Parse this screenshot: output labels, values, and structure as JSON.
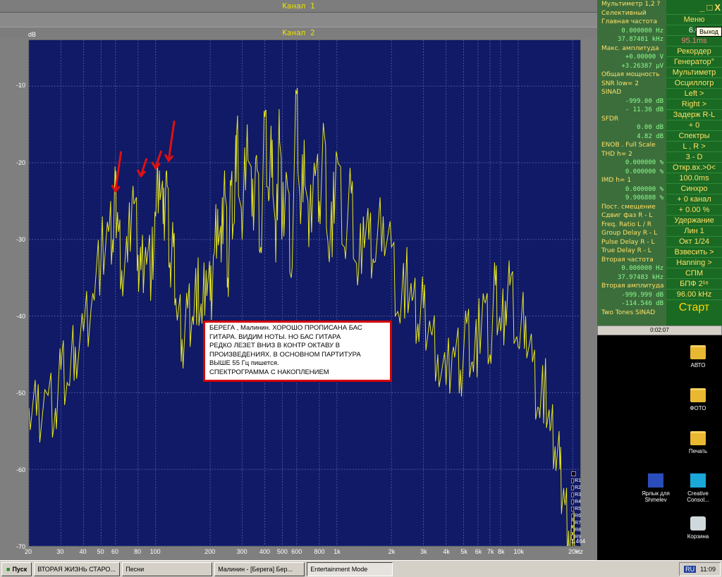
{
  "channel1_title": "Канал 1",
  "channel2_title": "Канал 2",
  "y_unit": "dB",
  "y_ticks": [
    "-10",
    "-20",
    "-30",
    "-40",
    "-50",
    "-60",
    "-70"
  ],
  "x_ticks": [
    "20",
    "30",
    "40",
    "50",
    "60",
    "80",
    "100",
    "200",
    "300",
    "400",
    "500",
    "600",
    "800",
    "1k",
    "2k",
    "3k",
    "4k",
    "5k",
    "6k",
    "7k",
    "8k",
    "10k",
    "20k",
    "Hz"
  ],
  "annotation": {
    "lines": [
      "БЕРЕГА , Малинин. ХОРОШО ПРОПИСАНА БАС",
      "ГИТАРА. ВИДИМ НОТЫ. НО БАС ГИТАРА",
      "РЕДКО ЛЕЗЕТ ВНИЗ В КОНТР ОКТАВУ В",
      "ПРОИЗВЕДЕНИЯХ. В ОСНОВНОМ ПАРТИТУРА",
      "ВЫШЕ 55 Гц пишется.",
      "СПЕКТРОГРАММА С НАКОПЛЕНИЕМ"
    ]
  },
  "legend": [
    "",
    "R1",
    "R2",
    "R3",
    "R4",
    "R5",
    "R6",
    "R7",
    "R8",
    "R9"
  ],
  "min_value": "1.464",
  "panel": [
    {
      "t": "Мультиметр 1,2  ?",
      "k": "h"
    },
    {
      "t": "Селективный",
      "k": "h"
    },
    {
      "t": "Главная частота",
      "k": "h"
    },
    {
      "t": "0.000000  Hz",
      "k": "v"
    },
    {
      "t": "37.87481 kHz",
      "k": "v"
    },
    {
      "t": "Макс. амплитуда",
      "k": "h"
    },
    {
      "t": "+0.00000  V",
      "k": "v"
    },
    {
      "t": "+3.26387 μV",
      "k": "v"
    },
    {
      "t": "Общая мощность",
      "k": "h"
    },
    {
      "t": "SNR    low=   2",
      "k": "h"
    },
    {
      "t": "SINAD",
      "k": "h"
    },
    {
      "t": "-999.00 dB",
      "k": "v"
    },
    {
      "t": "- 11.36 dB",
      "k": "v"
    },
    {
      "t": "SFDR",
      "k": "h"
    },
    {
      "t": "0.00 dB",
      "k": "v"
    },
    {
      "t": "4.82 dB",
      "k": "v"
    },
    {
      "t": "ENOB . Full Scale",
      "k": "h"
    },
    {
      "t": "THD     h=   2",
      "k": "h"
    },
    {
      "t": "0.000000 %",
      "k": "v"
    },
    {
      "t": "0.000000 %",
      "k": "v"
    },
    {
      "t": "IMD     h=   1",
      "k": "h"
    },
    {
      "t": "0.000000 %",
      "k": "v"
    },
    {
      "t": "9.906808 %",
      "k": "v"
    },
    {
      "t": "Пост. смещение",
      "k": "h"
    },
    {
      "t": "Сдвиг фаз R - L",
      "k": "h"
    },
    {
      "t": "Freq. Ratio  L / R",
      "k": "h"
    },
    {
      "t": "Group Delay R - L",
      "k": "h"
    },
    {
      "t": "Pulse Delay R - L",
      "k": "h"
    },
    {
      "t": "True Delay R - L",
      "k": "h"
    },
    {
      "t": "Вторая частота",
      "k": "h"
    },
    {
      "t": "0.000000  Hz",
      "k": "v"
    },
    {
      "t": "37.97483 kHz",
      "k": "v"
    },
    {
      "t": "Вторая амплитуда",
      "k": "h"
    },
    {
      "t": "-999.999 dB",
      "k": "v"
    },
    {
      "t": "-114.546 dB",
      "k": "v"
    },
    {
      "t": "Two Tones SINAD",
      "k": "h"
    }
  ],
  "menu": {
    "head": "Меню",
    "val1": "6.0",
    "val2": "95.1ms",
    "items": [
      "Рекордер",
      "Генератор°",
      "Мультиметр",
      "Осциллогр",
      "Left  >",
      "Right  >",
      "Задерж  R-L",
      "+   0",
      "Спектры",
      "L , R  >",
      "3 - D",
      "Откр.вх.>0<",
      "100.0ms",
      "Синхро",
      "+  0 канал",
      "+  0.00 %",
      "Удержание",
      "Лин   1",
      "Окт  1/24",
      "Взвесить >",
      "Hanning >",
      "СПМ",
      "БПФ  2¹⁶",
      "96.00 kHz"
    ],
    "start": "Старт"
  },
  "tooltip": "Выход",
  "timebar": "0:02:07",
  "desktop_icons": [
    {
      "label": "АВТО"
    },
    {
      "label": "ФОТО"
    },
    {
      "label": "Печать"
    },
    {
      "label": "Ярлык для Shmelev"
    },
    {
      "label": "Creative Consol..."
    },
    {
      "label": "Корзина"
    }
  ],
  "taskbar": {
    "start": "Пуск",
    "items": [
      "ВТОРАЯ ЖИЗНЬ СТАРО...",
      "Песни",
      "Малинин - [Берега] Бер...",
      "Entertainment Mode"
    ],
    "lang": "RU",
    "time": "11:09"
  },
  "chart_data": {
    "type": "line",
    "x_scale": "log",
    "xlim": [
      20,
      22000
    ],
    "ylim": [
      -70,
      -4
    ],
    "ylabel": "dB",
    "x": [
      20,
      22,
      25,
      28,
      30,
      33,
      36,
      40,
      45,
      50,
      55,
      58,
      60,
      62,
      65,
      70,
      75,
      80,
      83,
      88,
      95,
      100,
      105,
      110,
      115,
      120,
      125,
      130,
      140,
      150,
      160,
      170,
      180,
      190,
      200,
      210,
      220,
      230,
      240,
      250,
      260,
      270,
      280,
      300,
      320,
      340,
      360,
      380,
      400,
      420,
      440,
      460,
      480,
      500,
      530,
      560,
      600,
      630,
      660,
      700,
      750,
      800,
      850,
      900,
      950,
      1000,
      1100,
      1200,
      1300,
      1400,
      1500,
      1600,
      1800,
      2000,
      2200,
      2400,
      2600,
      2800,
      3000,
      3300,
      3600,
      4000,
      4400,
      4800,
      5200,
      5600,
      6000,
      6500,
      7000,
      7500,
      8000,
      8500,
      9000,
      10000,
      11000,
      12000,
      13000,
      14000,
      15000,
      16000,
      17000,
      18000,
      19000,
      20000,
      21000
    ],
    "y": [
      -52,
      -53,
      -50,
      -52,
      -47,
      -49,
      -44,
      -42,
      -37,
      -32,
      -29,
      -30,
      -24,
      -28,
      -34,
      -33,
      -23,
      -32,
      -34,
      -31,
      -34,
      -27,
      -21,
      -28,
      -21,
      -33,
      -31,
      -39,
      -43,
      -39,
      -40,
      -36,
      -41,
      -34,
      -38,
      -32,
      -26,
      -33,
      -21,
      -35,
      -23,
      -28,
      -16,
      -30,
      -15,
      -27,
      -19,
      -31,
      -14,
      -25,
      -17,
      -33,
      -13,
      -28,
      -22,
      -35,
      -11,
      -28,
      -17,
      -31,
      -20,
      -25,
      -16,
      -32,
      -27,
      -19,
      -31,
      -24,
      -36,
      -27,
      -30,
      -33,
      -27,
      -31,
      -40,
      -35,
      -38,
      -41,
      -39,
      -42,
      -45,
      -49,
      -44,
      -47,
      -41,
      -46,
      -43,
      -38,
      -45,
      -36,
      -42,
      -38,
      -36,
      -44,
      -40,
      -46,
      -52,
      -49,
      -55,
      -57,
      -60,
      -64,
      -68,
      -70,
      -70
    ]
  }
}
